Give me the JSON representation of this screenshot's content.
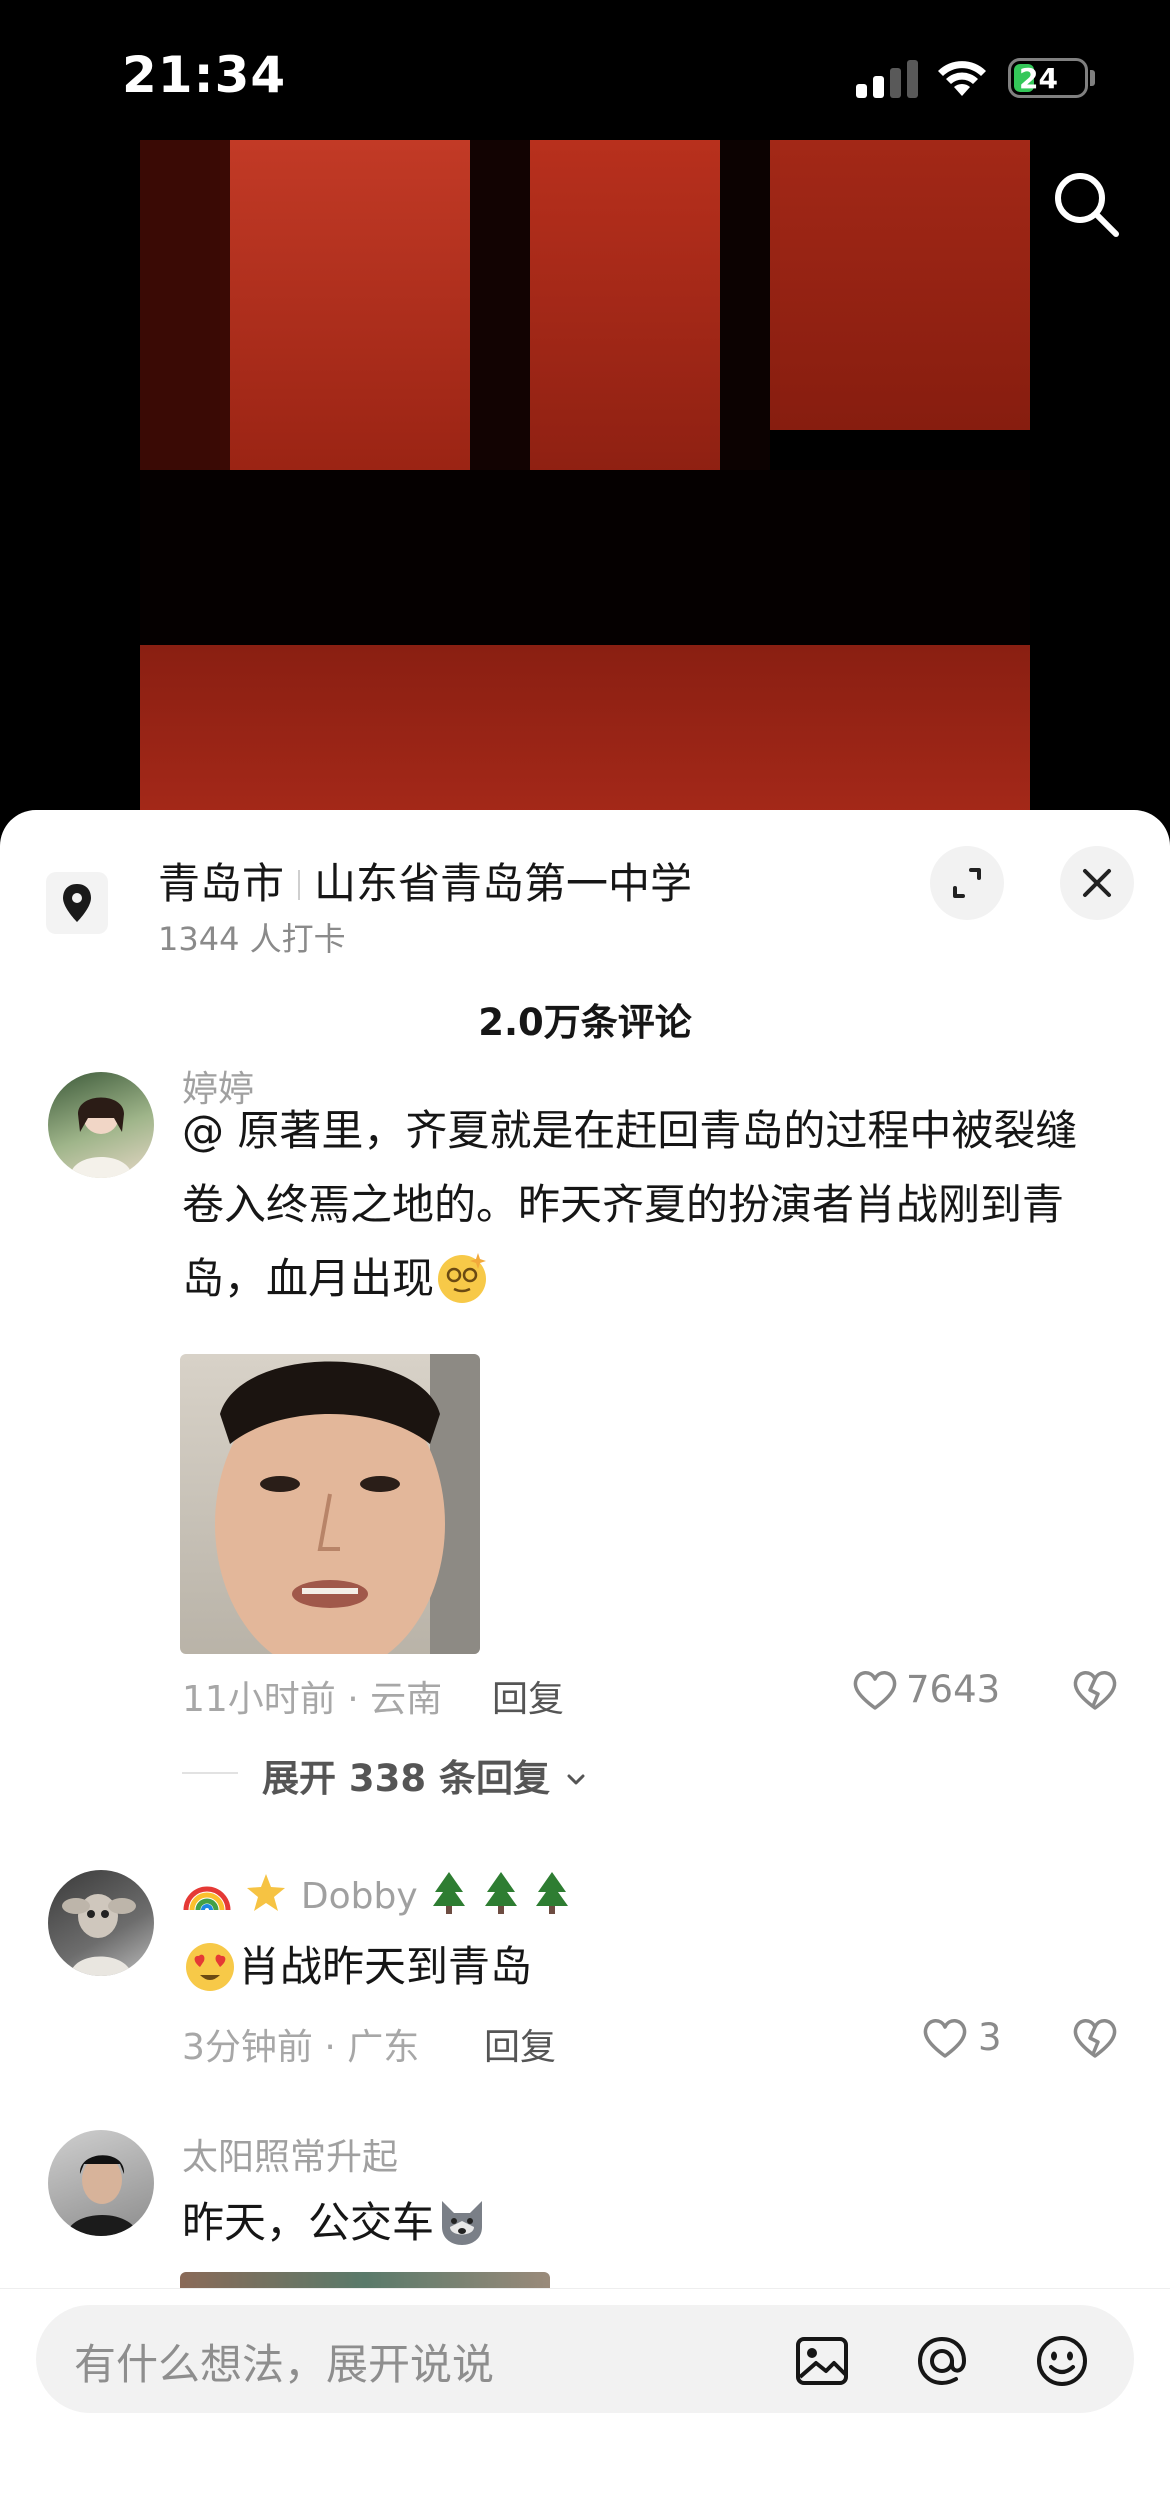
{
  "status_bar": {
    "time": "21:34",
    "battery": "24"
  },
  "location": {
    "city": "青岛市",
    "place": "山东省青岛第一中学",
    "checkins": "1344 人打卡"
  },
  "comments_header": {
    "count": "2.0万条评论"
  },
  "comments": [
    {
      "username": "婷婷",
      "text_line1": "@ 原著里，齐夏就是在赶回青岛的过程中被裂缝",
      "text_line2": "卷入终焉之地的。昨天齐夏的扮演者肖战刚到青",
      "text_line3": "岛，血月出现",
      "meta": "11小时前 · 云南",
      "reply": "回复",
      "likes": "7643",
      "expand": "展开 338 条回复"
    },
    {
      "username": "Dobby",
      "text": "肖战昨天到青岛",
      "meta": "3分钟前 · 广东",
      "reply": "回复",
      "likes": "3"
    },
    {
      "username": "太阳照常升起",
      "text": "昨天，公交车"
    }
  ],
  "input": {
    "placeholder": "有什么想法，展开说说"
  },
  "icons": {
    "search": "search-icon",
    "location": "location-pin-icon",
    "expand": "expand-icon",
    "close": "close-icon",
    "like": "heart-icon",
    "dislike": "broken-heart-icon",
    "image": "image-icon",
    "mention": "at-icon",
    "emoji": "emoji-icon"
  }
}
